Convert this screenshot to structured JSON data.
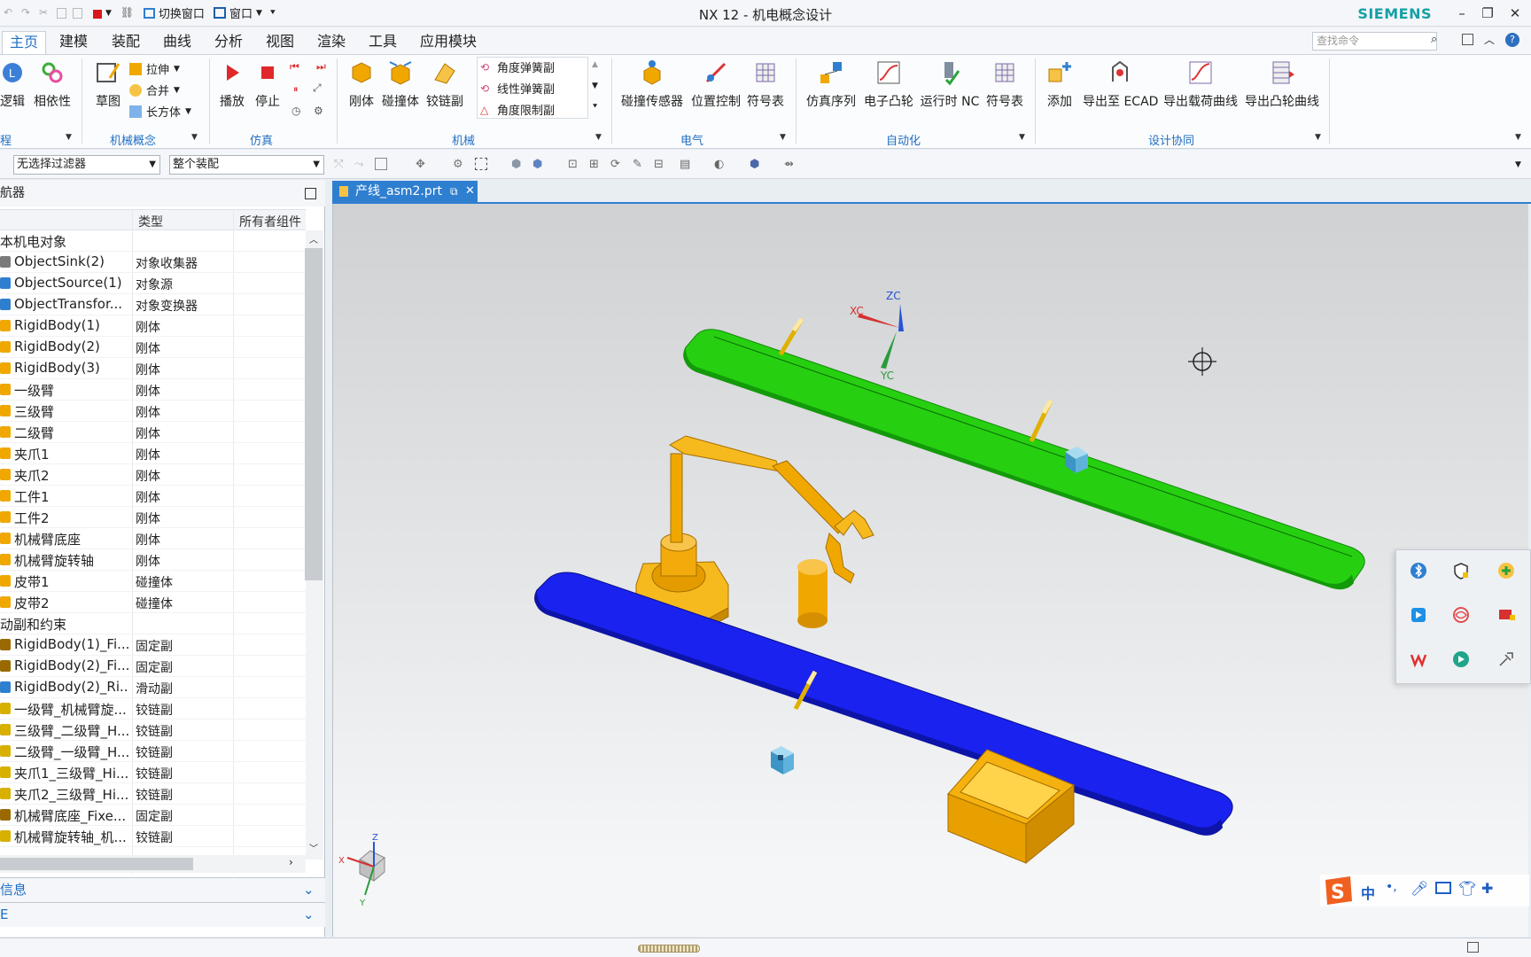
{
  "app": {
    "title": "NX 12 - 机电概念设计",
    "brand": "SIEMENS",
    "switch_window": "切换窗口",
    "window_menu": "窗口"
  },
  "tabs": [
    "主页",
    "建模",
    "装配",
    "曲线",
    "分析",
    "视图",
    "渲染",
    "工具",
    "应用模块"
  ],
  "search_placeholder": "查找命令",
  "ribbon": {
    "engineering": {
      "buttons": [
        "逻辑",
        "相依性"
      ],
      "group": "程"
    },
    "mechatronics": {
      "sketch": "草图",
      "pull": "拉伸",
      "merge": "合并",
      "box": "长方体",
      "group": "机械概念"
    },
    "simulation": {
      "play": "播放",
      "stop": "停止",
      "group": "仿真"
    },
    "mechanical": {
      "buttons": [
        "刚体",
        "碰撞体",
        "铰链副"
      ],
      "list": [
        "角度弹簧副",
        "线性弹簧副",
        "角度限制副"
      ],
      "group": "机械"
    },
    "electrical": {
      "buttons": [
        "碰撞传感器",
        "位置控制",
        "符号表"
      ],
      "group": "电气"
    },
    "automation": {
      "buttons": [
        "仿真序列",
        "电子凸轮",
        "运行时 NC",
        "符号表"
      ],
      "group": "自动化"
    },
    "collab": {
      "buttons": [
        "添加",
        "导出至 ECAD",
        "导出载荷曲线",
        "导出凸轮曲线"
      ],
      "group": "设计协同"
    }
  },
  "toolbar": {
    "filter": "无选择过滤器",
    "scope": "整个装配"
  },
  "navigator": {
    "title": "航器",
    "columns": [
      "",
      "类型",
      "所有者组件"
    ],
    "groups": [
      {
        "label": "本机电对象",
        "rows": [
          {
            "name": "ObjectSink(2)",
            "type": "对象收集器"
          },
          {
            "name": "ObjectSource(1)",
            "type": "对象源"
          },
          {
            "name": "ObjectTransfor...",
            "type": "对象变换器"
          },
          {
            "name": "RigidBody(1)",
            "type": "刚体"
          },
          {
            "name": "RigidBody(2)",
            "type": "刚体"
          },
          {
            "name": "RigidBody(3)",
            "type": "刚体"
          },
          {
            "name": "一级臂",
            "type": "刚体"
          },
          {
            "name": "三级臂",
            "type": "刚体"
          },
          {
            "name": "二级臂",
            "type": "刚体"
          },
          {
            "name": "夹爪1",
            "type": "刚体"
          },
          {
            "name": "夹爪2",
            "type": "刚体"
          },
          {
            "name": "工件1",
            "type": "刚体"
          },
          {
            "name": "工件2",
            "type": "刚体"
          },
          {
            "name": "机械臂底座",
            "type": "刚体"
          },
          {
            "name": "机械臂旋转轴",
            "type": "刚体"
          },
          {
            "name": "皮带1",
            "type": "碰撞体"
          },
          {
            "name": "皮带2",
            "type": "碰撞体"
          }
        ]
      },
      {
        "label": "动副和约束",
        "rows": [
          {
            "name": "RigidBody(1)_Fi...",
            "type": "固定副"
          },
          {
            "name": "RigidBody(2)_Fi...",
            "type": "固定副"
          },
          {
            "name": "RigidBody(2)_Ri...",
            "type": "滑动副"
          },
          {
            "name": "一级臂_机械臂旋...",
            "type": "铰链副"
          },
          {
            "name": "三级臂_二级臂_H...",
            "type": "铰链副"
          },
          {
            "name": "二级臂_一级臂_H...",
            "type": "铰链副"
          },
          {
            "name": "夹爪1_三级臂_Hi...",
            "type": "铰链副"
          },
          {
            "name": "夹爪2_三级臂_Hi...",
            "type": "铰链副"
          },
          {
            "name": "机械臂底座_Fixe...",
            "type": "固定副"
          },
          {
            "name": "机械臂旋转轴_机...",
            "type": "铰链副"
          }
        ]
      }
    ],
    "bottom_panels": [
      "信息",
      "E"
    ]
  },
  "viewport": {
    "tab": "产线_asm2.prt",
    "triad": {
      "xc": "XC",
      "yc": "YC",
      "zc": "ZC"
    },
    "mini_triad": {
      "x": "X",
      "y": "Y",
      "z": "Z"
    }
  },
  "ime": {
    "mode": "中"
  },
  "colors": {
    "accent": "#2f7fd0",
    "belt_top": "#26d011",
    "belt_bottom": "#1a22f0",
    "arm": "#f0a800"
  }
}
